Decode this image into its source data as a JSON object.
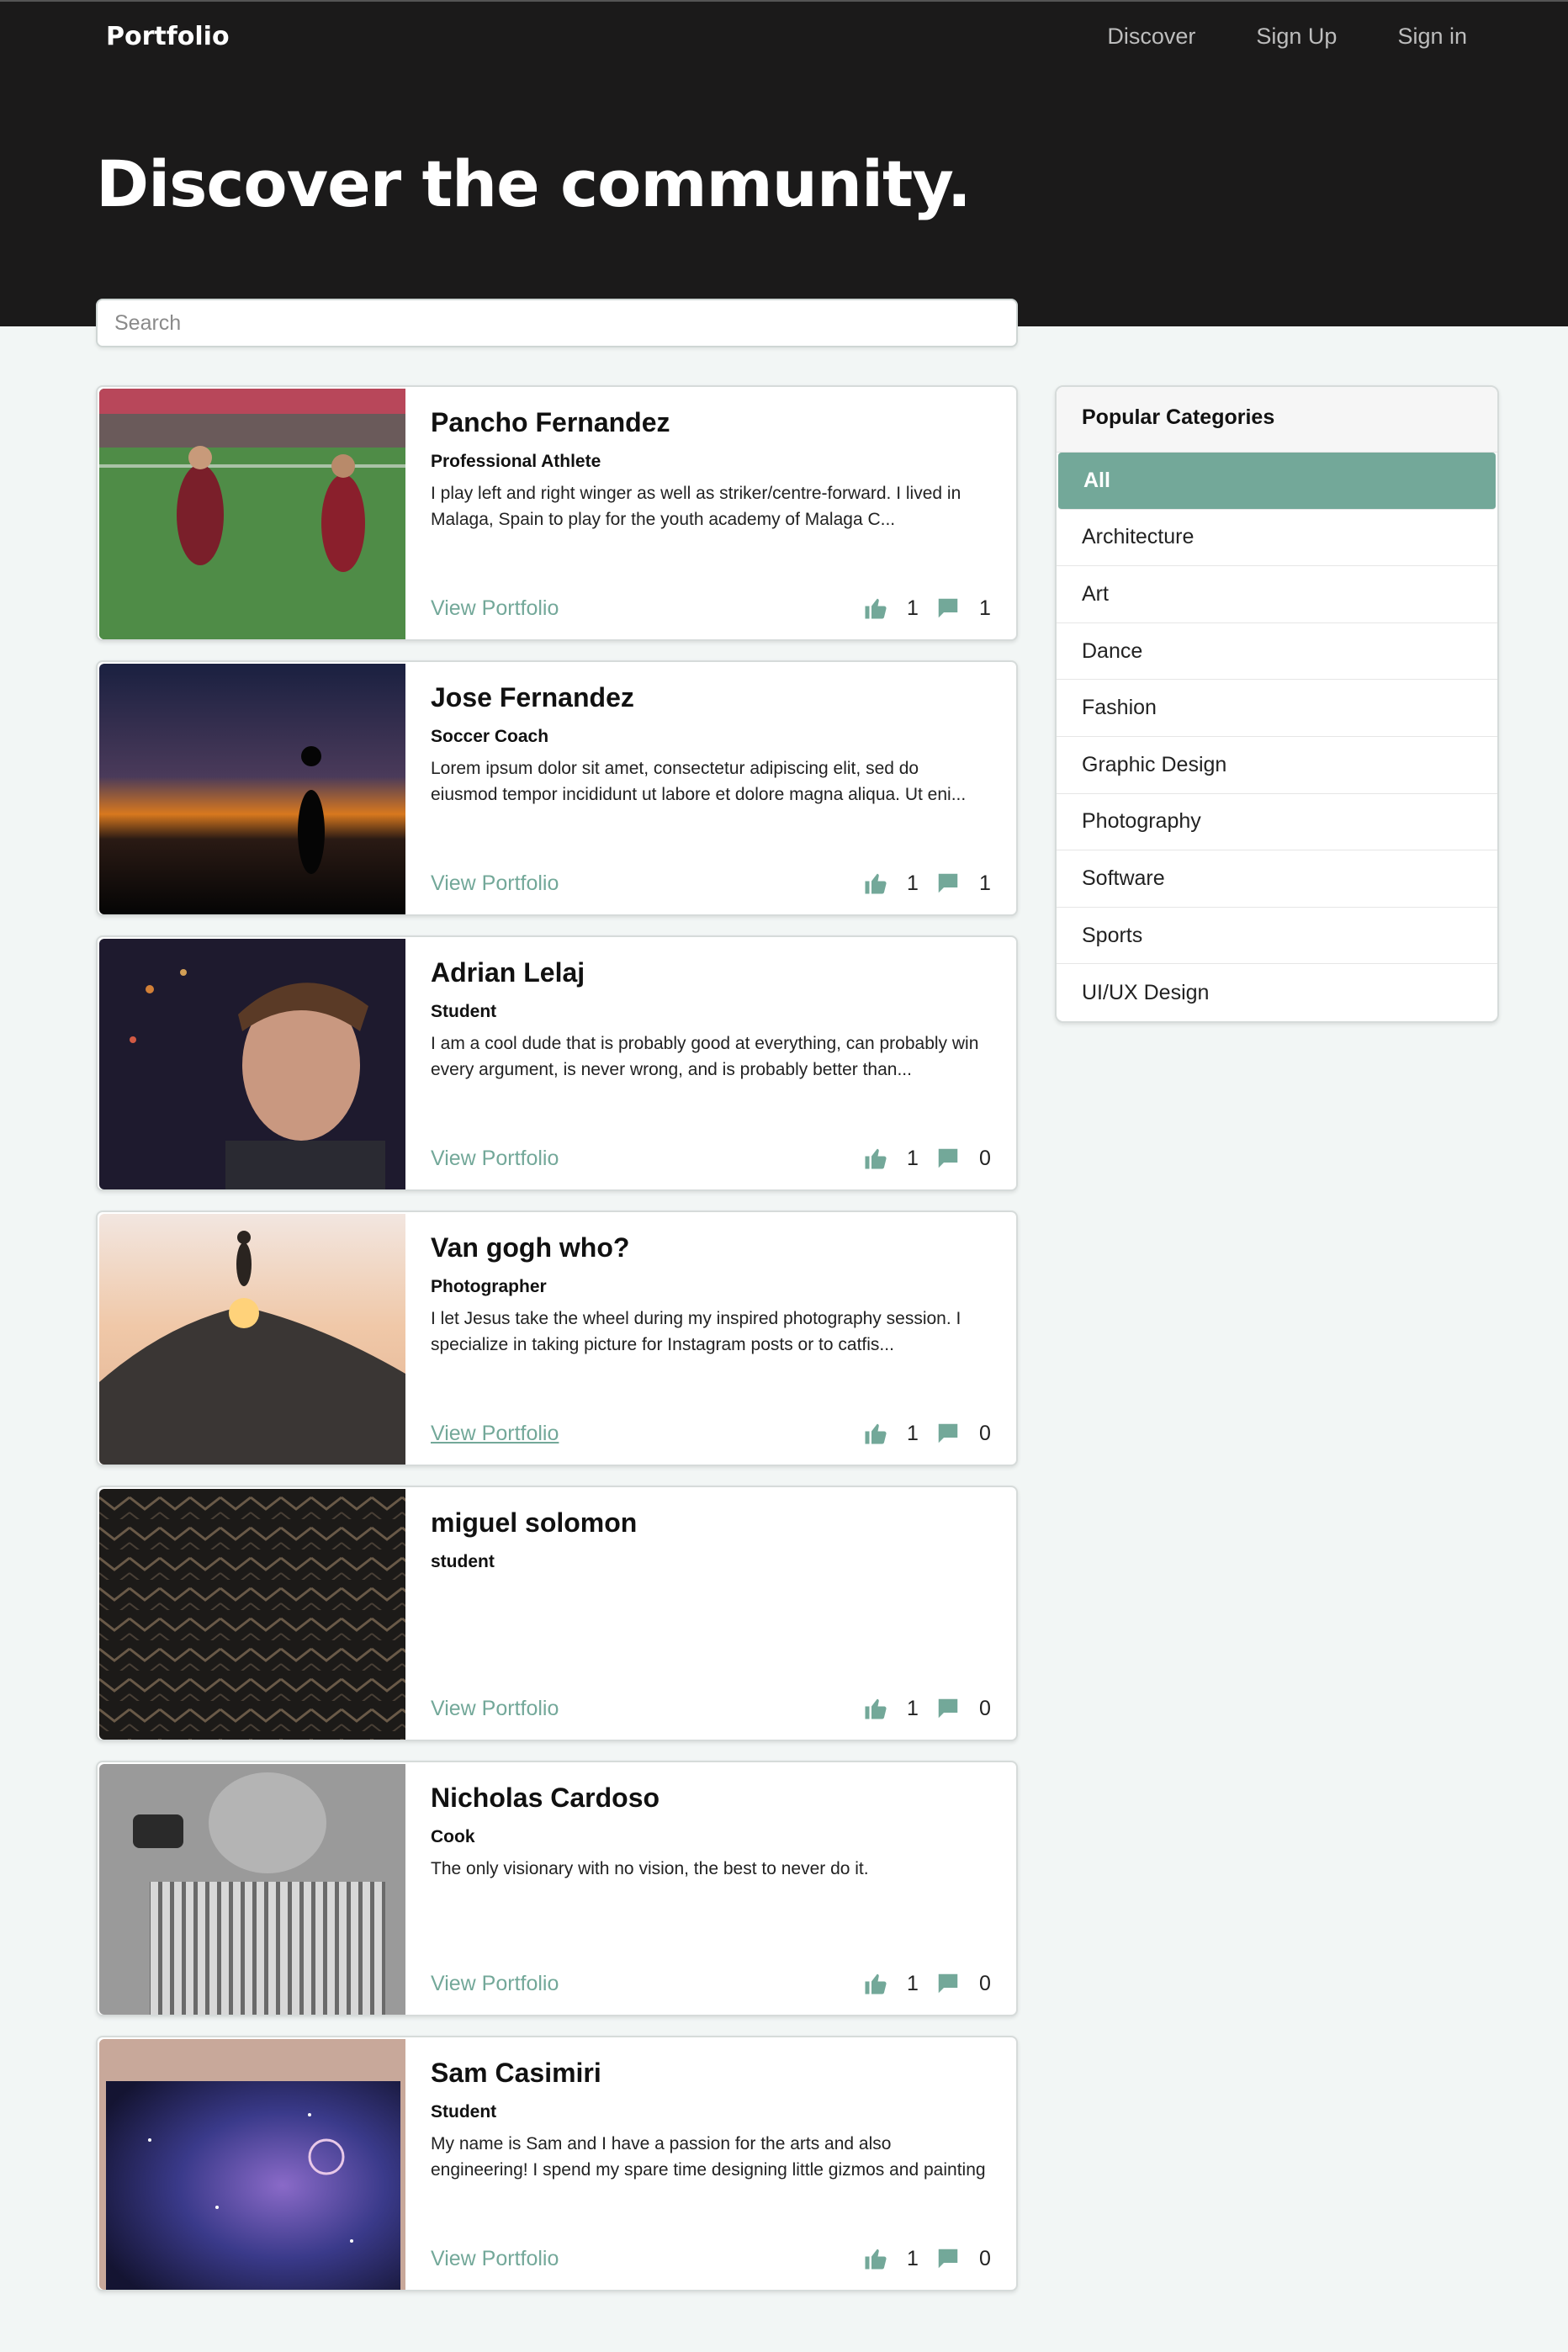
{
  "header": {
    "brand": "Portfolio",
    "nav": [
      "Discover",
      "Sign Up",
      "Sign in"
    ],
    "title": "Discover the community."
  },
  "search": {
    "placeholder": "Search",
    "value": ""
  },
  "accent_color": "#73a899",
  "profiles": [
    {
      "name": "Pancho Fernandez",
      "role": "Professional Athlete",
      "bio": "I play left and right winger as well as striker/centre-forward. I lived in Malaga, Spain to play for the youth academy of Malaga C...",
      "link": "View Portfolio",
      "likes": "1",
      "comments": "1",
      "image": "soccer-players-photo"
    },
    {
      "name": "Jose Fernandez",
      "role": "Soccer Coach",
      "bio": "Lorem ipsum dolor sit amet, consectetur adipiscing elit, sed do eiusmod tempor incididunt ut labore et dolore magna aliqua. Ut eni...",
      "link": "View Portfolio",
      "likes": "1",
      "comments": "1",
      "image": "sunset-silhouette-photo"
    },
    {
      "name": "Adrian Lelaj",
      "role": "Student",
      "bio": "I am a cool dude that is probably good at everything, can probably win every argument, is never wrong, and is probably better than...",
      "link": "View Portfolio",
      "likes": "1",
      "comments": "0",
      "image": "portrait-night-photo"
    },
    {
      "name": "Van gogh who?",
      "role": "Photographer",
      "bio": "I let Jesus take the wheel during my inspired photography session. I specialize in taking picture for Instagram posts or to catfis...",
      "link": "View Portfolio",
      "likes": "1",
      "comments": "0",
      "image": "rock-walker-photo"
    },
    {
      "name": "miguel solomon",
      "role": "student",
      "bio": "",
      "link": "View Portfolio",
      "likes": "1",
      "comments": "0",
      "image": "pattern-texture-photo"
    },
    {
      "name": "Nicholas Cardoso",
      "role": "Cook",
      "bio": "The only visionary with no vision, the best to never do it.",
      "link": "View Portfolio",
      "likes": "1",
      "comments": "0",
      "image": "bw-portrait-photo"
    },
    {
      "name": "Sam Casimiri",
      "role": "Student",
      "bio": "My name is Sam and I have a passion for the arts and also engineering! I spend my spare time designing little gizmos and painting",
      "link": "View Portfolio",
      "likes": "1",
      "comments": "0",
      "image": "galaxy-painting-photo"
    }
  ],
  "sidebar": {
    "title": "Popular Categories",
    "categories": [
      "All",
      "Architecture",
      "Art",
      "Dance",
      "Fashion",
      "Graphic Design",
      "Photography",
      "Software",
      "Sports",
      "UI/UX Design"
    ],
    "active": "All"
  }
}
